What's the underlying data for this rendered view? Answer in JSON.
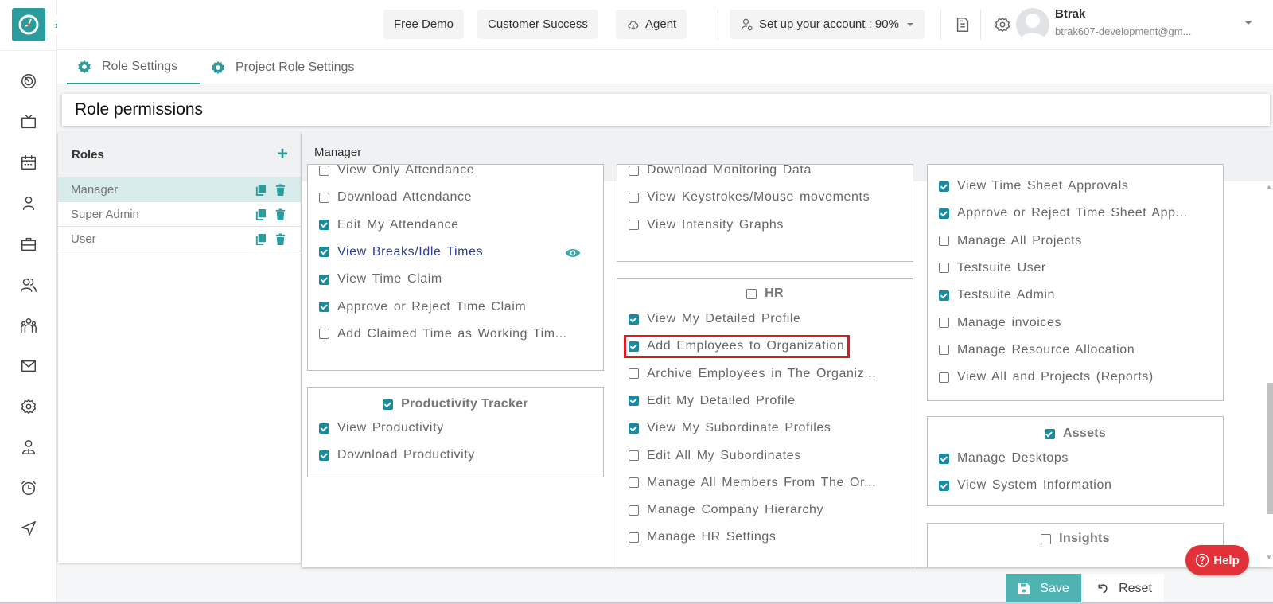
{
  "topbar": {
    "free_demo": "Free Demo",
    "customer_success": "Customer Success",
    "agent": "Agent",
    "setup_account": "Set up your account : 90%",
    "user_name": "Btrak",
    "user_email": "btrak607-development@gm..."
  },
  "sidebar": {
    "expand_glyph": "›››",
    "icons": [
      "dashboard-icon",
      "tv-icon",
      "calendar-icon",
      "user-icon",
      "briefcase-icon",
      "users-icon",
      "team-icon",
      "mail-icon",
      "settings-icon",
      "profile-icon",
      "alarm-icon",
      "send-icon"
    ]
  },
  "tabs": [
    {
      "label": "Role Settings",
      "active": true
    },
    {
      "label": "Project Role Settings",
      "active": false
    }
  ],
  "page_title": "Role permissions",
  "roles": {
    "title": "Roles",
    "items": [
      {
        "name": "Manager",
        "selected": true
      },
      {
        "name": "Super Admin",
        "selected": false
      },
      {
        "name": "User",
        "selected": false
      }
    ]
  },
  "permissions": {
    "role_name": "Manager",
    "col1_box1": [
      {
        "label": "View Only Attendance",
        "checked": false
      },
      {
        "label": "Download Attendance",
        "checked": false
      },
      {
        "label": "Edit My Attendance",
        "checked": true
      },
      {
        "label": "View Breaks/Idle Times",
        "checked": true
      },
      {
        "label": "View Time Claim",
        "checked": true
      },
      {
        "label": "Approve or Reject Time Claim",
        "checked": true
      },
      {
        "label": "Add Claimed Time as Working Tim...",
        "checked": false
      }
    ],
    "productivity": {
      "title": "Productivity Tracker",
      "checked": true,
      "items": [
        {
          "label": "View Productivity",
          "checked": true
        },
        {
          "label": "Download Productivity",
          "checked": true
        }
      ]
    },
    "col2_box1": [
      {
        "label": "Download Monitoring Data",
        "checked": false
      },
      {
        "label": "View Keystrokes/Mouse movements",
        "checked": false
      },
      {
        "label": "View Intensity Graphs",
        "checked": false
      }
    ],
    "hr": {
      "title": "HR",
      "checked": false,
      "items": [
        {
          "label": "View My Detailed Profile",
          "checked": true
        },
        {
          "label": "Add Employees to Organization",
          "checked": true
        },
        {
          "label": "Archive Employees in The Organiz...",
          "checked": false
        },
        {
          "label": "Edit My Detailed Profile",
          "checked": true
        },
        {
          "label": "View My Subordinate Profiles",
          "checked": true
        },
        {
          "label": "Edit All My Subordinates",
          "checked": false
        },
        {
          "label": "Manage All Members From The Or...",
          "checked": false
        },
        {
          "label": "Manage Company Hierarchy",
          "checked": false
        },
        {
          "label": "Manage HR Settings",
          "checked": false
        }
      ]
    },
    "col3_box1": [
      {
        "label": "View Time Sheet Approvals",
        "checked": true
      },
      {
        "label": "Approve or Reject Time Sheet App...",
        "checked": true
      },
      {
        "label": "Manage All Projects",
        "checked": false
      },
      {
        "label": "Testsuite User",
        "checked": false
      },
      {
        "label": "Testsuite Admin",
        "checked": true
      },
      {
        "label": "Manage invoices",
        "checked": false
      },
      {
        "label": "Manage Resource Allocation",
        "checked": false
      },
      {
        "label": "View All and Projects (Reports)",
        "checked": false
      }
    ],
    "assets": {
      "title": "Assets",
      "checked": true,
      "items": [
        {
          "label": "Manage Desktops",
          "checked": true
        },
        {
          "label": "View System Information",
          "checked": true
        }
      ]
    },
    "insights": {
      "title": "Insights",
      "checked": false
    }
  },
  "actions": {
    "save": "Save",
    "reset": "Reset",
    "help": "Help"
  },
  "colors": {
    "accent": "#2a9c9c",
    "checkbox": "#1a8a9e",
    "help": "#e3313a",
    "highlight": "#e01b1b"
  }
}
